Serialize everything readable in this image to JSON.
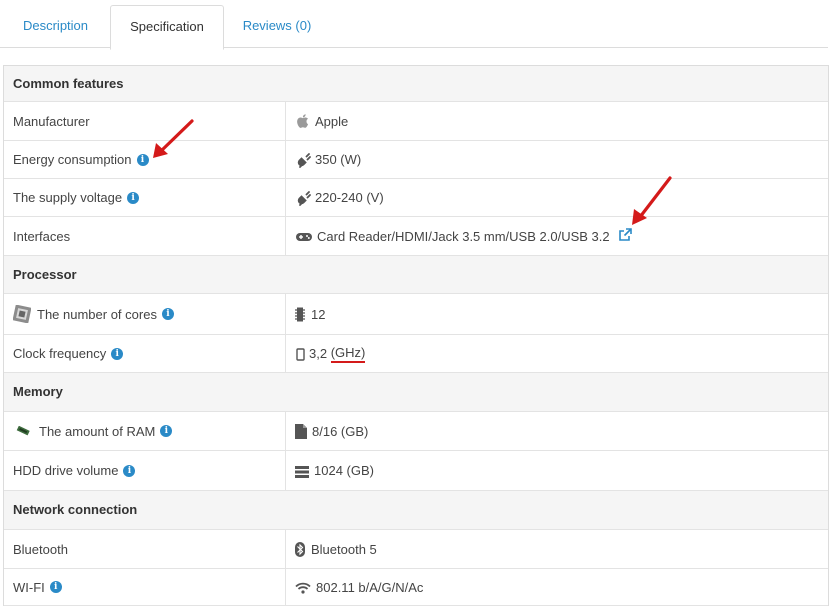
{
  "tabs": [
    {
      "label": "Description",
      "active": false
    },
    {
      "label": "Specification",
      "active": true
    },
    {
      "label": "Reviews (0)",
      "active": false
    }
  ],
  "spec": {
    "group_common": "Common features",
    "manufacturer_label": "Manufacturer",
    "manufacturer_value": "Apple",
    "energy_label": "Energy consumption",
    "energy_value": "350 (W)",
    "voltage_label": "The supply voltage",
    "voltage_value": "220-240 (V)",
    "interfaces_label": "Interfaces",
    "interfaces_value": "Card Reader/HDMI/Jack 3.5 mm/USB 2.0/USB 3.2",
    "group_processor": "Processor",
    "cores_label": "The number of cores",
    "cores_value": "12",
    "clock_label": "Clock frequency",
    "clock_number": "3,2",
    "clock_unit": "(GHz)",
    "group_memory": "Memory",
    "ram_label": "The amount of RAM",
    "ram_value": "8/16 (GB)",
    "hdd_label": "HDD drive volume",
    "hdd_value": "1024 (GB)",
    "group_network": "Network connection",
    "bluetooth_label": "Bluetooth",
    "bluetooth_value": "Bluetooth 5",
    "wifi_label": "WI-FI",
    "wifi_value": "802.11 b/A/G/N/Ac",
    "info_glyph": "i"
  },
  "colors": {
    "link": "#2a8ac7",
    "annotation": "#d41a1a"
  }
}
